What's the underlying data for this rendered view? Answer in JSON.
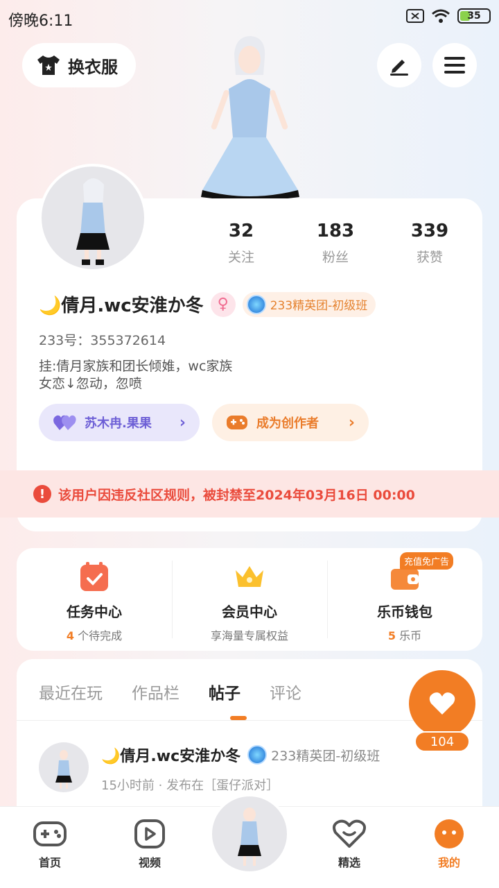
{
  "status_bar": {
    "time": "傍晚6:11",
    "battery": "35"
  },
  "header": {
    "outfit_label": "换衣服"
  },
  "profile": {
    "stats": [
      {
        "value": "32",
        "label": "关注"
      },
      {
        "value": "183",
        "label": "粉丝"
      },
      {
        "value": "339",
        "label": "获赞"
      }
    ],
    "name": "🌙倩月.wc安淮か冬",
    "gender_symbol": "♀",
    "rank": "233精英团-初级班",
    "uid": "233号：355372614",
    "bio_line1": "挂:倩月家族和团长倾婎，wc家族",
    "bio_line2": "女恋↓忽动，忽喷",
    "partner_label": "苏木冉.果果",
    "creator_label": "成为创作者"
  },
  "ban_notice": "该用户因违反社区规则，被封禁至2024年03月16日 00:00",
  "services": [
    {
      "title": "任务中心",
      "count": "4",
      "sub": " 个待完成"
    },
    {
      "title": "会员中心",
      "sub": "享海量专属权益"
    },
    {
      "title": "乐币钱包",
      "count": "5",
      "sub": " 乐币",
      "tag": "充值免广告"
    }
  ],
  "tabs": [
    "最近在玩",
    "作品栏",
    "帖子",
    "评论"
  ],
  "like_count": "104",
  "post": {
    "author": "🌙倩月.wc安淮か冬",
    "rank": "233精英团-初级班",
    "meta": "15小时前 · 发布在［蛋仔派对］"
  },
  "nav": {
    "home": "首页",
    "video": "视频",
    "featured": "精选",
    "mine": "我的"
  },
  "colors": {
    "accent": "#f27d24",
    "ban": "#ea4b3c",
    "purple": "#6d5fd6"
  }
}
